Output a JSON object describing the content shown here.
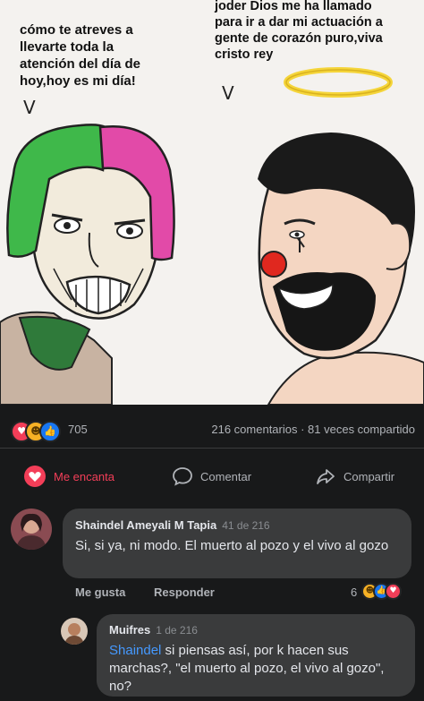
{
  "meme": {
    "left_caption": [
      "cómo te atreves a",
      "llevarte toda la",
      "atención del día de",
      "hoy,hoy es mi día!"
    ],
    "right_caption": [
      "joder Dios me ha llamado",
      "para ir a dar mi actuación a",
      "gente de corazón puro,viva",
      "cristo rey"
    ],
    "arrow_glyph": "V"
  },
  "post": {
    "reaction_count": "705",
    "reaction_icons": [
      "heart-react-icon",
      "haha-react-icon",
      "like-react-icon"
    ],
    "stats": "216 comentarios · 81 veces compartido",
    "actions": {
      "love_label": "Me encanta",
      "comment_label": "Comentar",
      "share_label": "Compartir"
    }
  },
  "comments": [
    {
      "author": "Shaindel Ameyali M Tapia",
      "time": "41 de 216",
      "text": "Si, si ya, ni modo. El muerto al pozo y el vivo al gozo",
      "like_label": "Me gusta",
      "reply_label": "Responder",
      "reaction_count": "6"
    },
    {
      "author": "Muifres",
      "time": "1 de 216",
      "mention": "Shaindel",
      "text": " si piensas así, por k hacen sus marchas?, \"el muerto al pozo, el vivo al gozo\", no?"
    }
  ],
  "colors": {
    "background": "#18191a",
    "bubble": "#3a3b3c",
    "love": "#f33e58",
    "link": "#4599ff"
  }
}
